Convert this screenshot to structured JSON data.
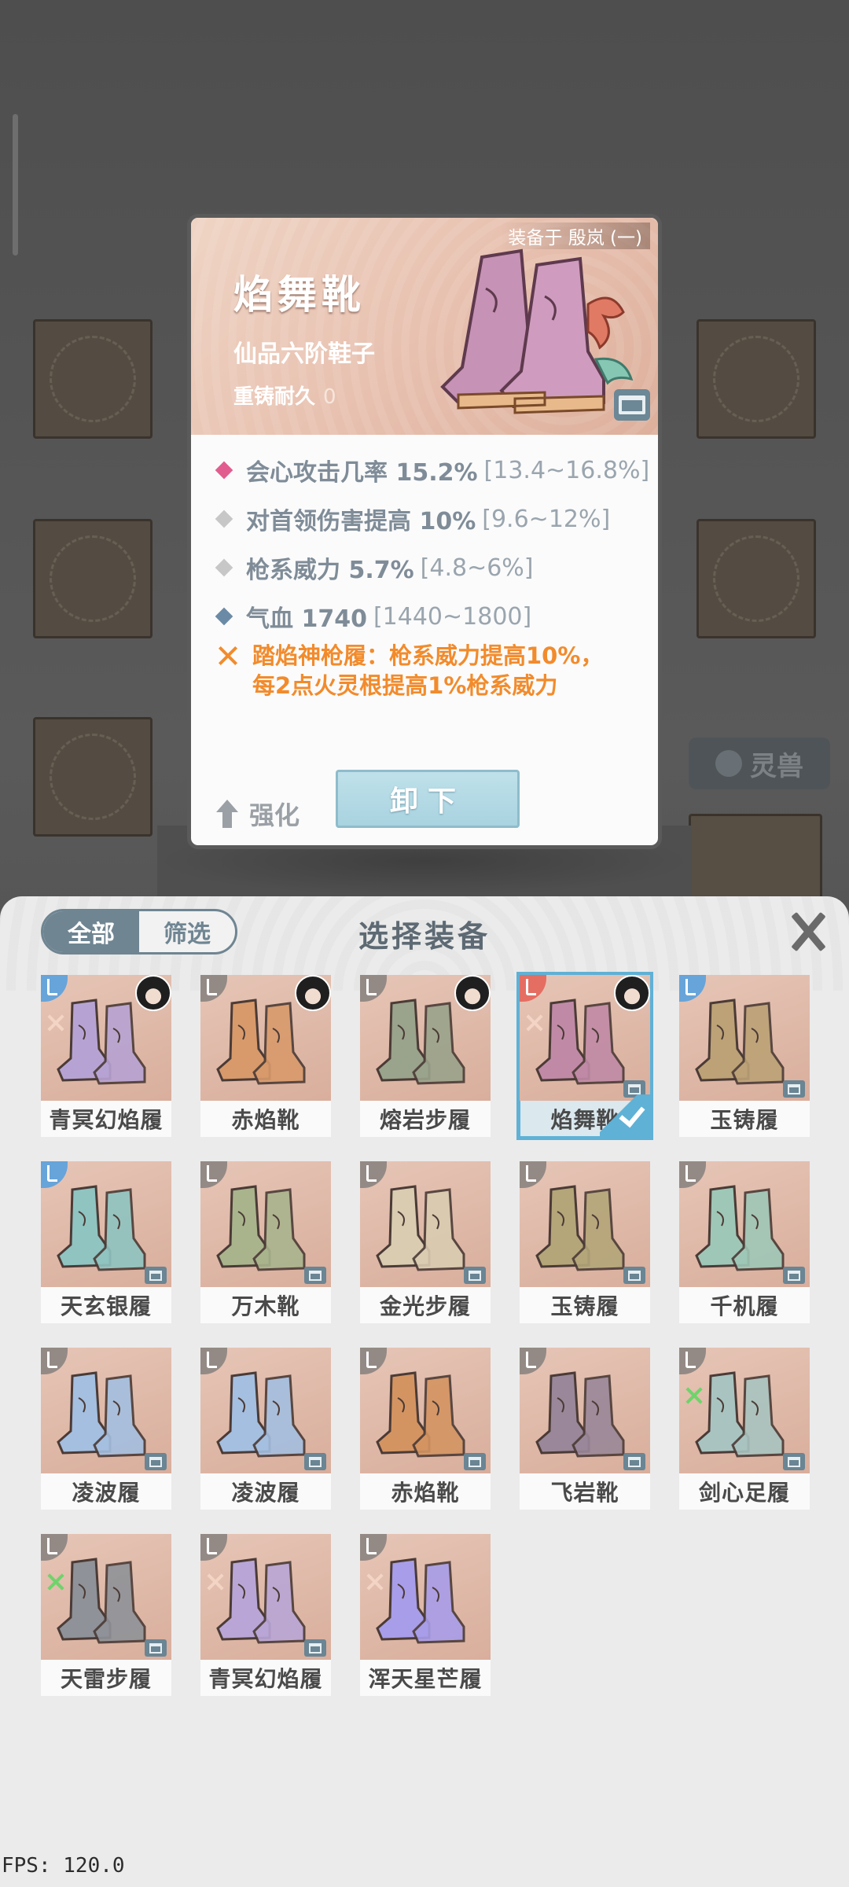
{
  "background": {
    "tab_label": "灵兽"
  },
  "detail": {
    "equipped_by": "装备于 殷岚 (一)",
    "name": "焰舞靴",
    "type": "仙品六阶鞋子",
    "recast_label": "重铸耐久",
    "recast_value": "0",
    "stats": [
      {
        "text": "会心攻击几率 15.2%",
        "range": "[13.4~16.8%]",
        "color": "#e15d8f"
      },
      {
        "text": "对首领伤害提高 10%",
        "range": "[9.6~12%]",
        "color": "#c7c7c7"
      },
      {
        "text": "枪系威力 5.7%",
        "range": "[4.8~6%]",
        "color": "#c7c7c7"
      },
      {
        "text": "气血 1740",
        "range": "[1440~1800]",
        "color": "#6b8aa6"
      }
    ],
    "set_bonus_line1": "踏焰神枪履：枪系威力提高10%，",
    "set_bonus_line2": "每2点火灵根提高1%枪系威力",
    "enhance_label": "强化",
    "unequip_label": "卸下"
  },
  "panel": {
    "tab_all": "全部",
    "tab_filter": "筛选",
    "title": "选择装备",
    "items": [
      {
        "name": "青冥幻焰履",
        "tag": "blue",
        "avatar": true,
        "set": "pink",
        "lock": false,
        "selected": false,
        "boot": "#b7a3d3"
      },
      {
        "name": "赤焰靴",
        "tag": "grey",
        "avatar": true,
        "set": "",
        "lock": false,
        "selected": false,
        "boot": "#d89a6b"
      },
      {
        "name": "熔岩步履",
        "tag": "grey",
        "avatar": true,
        "set": "",
        "lock": false,
        "selected": false,
        "boot": "#9aa38b"
      },
      {
        "name": "焰舞靴",
        "tag": "red",
        "avatar": true,
        "set": "pink",
        "lock": true,
        "selected": true,
        "boot": "#c08aa6"
      },
      {
        "name": "玉铸履",
        "tag": "blue",
        "avatar": false,
        "set": "",
        "lock": true,
        "selected": false,
        "boot": "#bca276"
      },
      {
        "name": "天玄银履",
        "tag": "blue",
        "avatar": false,
        "set": "",
        "lock": true,
        "selected": false,
        "boot": "#8fc4c1"
      },
      {
        "name": "万木靴",
        "tag": "grey",
        "avatar": false,
        "set": "",
        "lock": true,
        "selected": false,
        "boot": "#a9b48d"
      },
      {
        "name": "金光步履",
        "tag": "grey",
        "avatar": false,
        "set": "",
        "lock": true,
        "selected": false,
        "boot": "#d9ccb1"
      },
      {
        "name": "玉铸履",
        "tag": "grey",
        "avatar": false,
        "set": "",
        "lock": true,
        "selected": false,
        "boot": "#b4a679"
      },
      {
        "name": "千机履",
        "tag": "grey",
        "avatar": false,
        "set": "",
        "lock": true,
        "selected": false,
        "boot": "#9fc7b7"
      },
      {
        "name": "凌波履",
        "tag": "grey",
        "avatar": false,
        "set": "",
        "lock": true,
        "selected": false,
        "boot": "#a4bfe0"
      },
      {
        "name": "凌波履",
        "tag": "grey",
        "avatar": false,
        "set": "",
        "lock": true,
        "selected": false,
        "boot": "#a4bfe0"
      },
      {
        "name": "赤焰靴",
        "tag": "grey",
        "avatar": false,
        "set": "",
        "lock": true,
        "selected": false,
        "boot": "#d49461"
      },
      {
        "name": "飞岩靴",
        "tag": "grey",
        "avatar": false,
        "set": "",
        "lock": true,
        "selected": false,
        "boot": "#9a8799"
      },
      {
        "name": "剑心足履",
        "tag": "grey",
        "avatar": false,
        "set": "green",
        "lock": true,
        "selected": false,
        "boot": "#a9c4c0"
      },
      {
        "name": "天雷步履",
        "tag": "grey",
        "avatar": false,
        "set": "green",
        "lock": true,
        "selected": false,
        "boot": "#8f9298"
      },
      {
        "name": "青冥幻焰履",
        "tag": "grey",
        "avatar": false,
        "set": "pink",
        "lock": true,
        "selected": false,
        "boot": "#b9a6d6"
      },
      {
        "name": "浑天星芒履",
        "tag": "grey",
        "avatar": false,
        "set": "pink",
        "lock": false,
        "selected": false,
        "boot": "#a89de8"
      }
    ]
  },
  "fps": "FPS: 120.0"
}
